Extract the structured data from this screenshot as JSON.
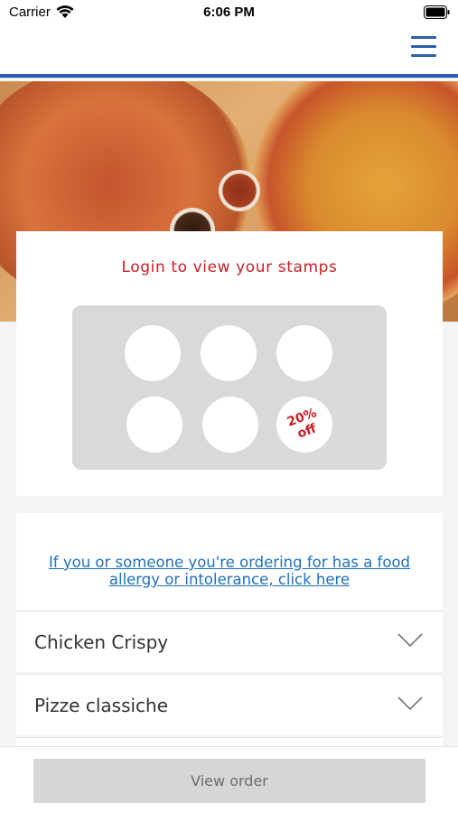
{
  "status_bar": {
    "carrier": "Carrier",
    "time": "6:06 PM"
  },
  "nav": {
    "menu_icon": "hamburger-menu-icon",
    "accent_color": "#2b5db0"
  },
  "hero": {
    "image": "pizza-photo"
  },
  "stamps": {
    "title": "Login to view your stamps",
    "title_color": "#c81e25",
    "slots": [
      "",
      "",
      "",
      "",
      "",
      ""
    ],
    "reward_label_line1": "20%",
    "reward_label_line2": "off"
  },
  "allergy": {
    "link_text": "If you or someone you're ordering for has a food allergy or intolerance, click here",
    "link_color": "#1f6fc0"
  },
  "categories": [
    {
      "label": "Chicken Crispy",
      "icon": "chevron-down-icon"
    },
    {
      "label": "Pizze classiche",
      "icon": "chevron-down-icon"
    }
  ],
  "footer": {
    "button_label": "View order"
  }
}
